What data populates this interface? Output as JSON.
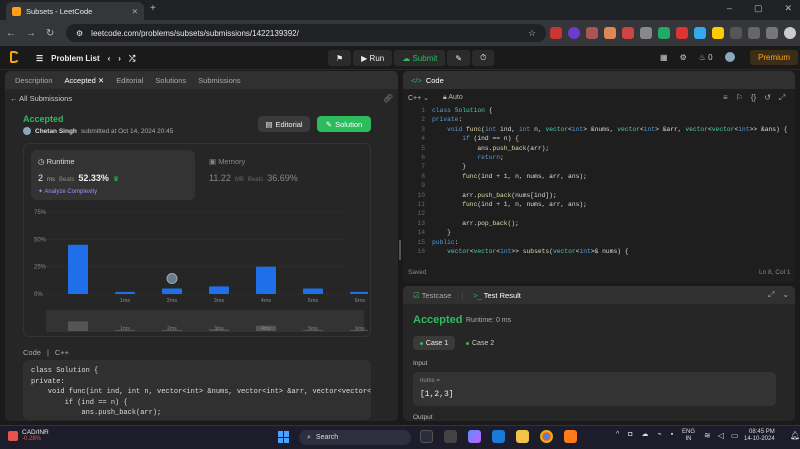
{
  "browser": {
    "tab_title": "Subsets - LeetCode",
    "url": "leetcode.com/problems/subsets/submissions/1422139392/"
  },
  "nav": {
    "problem_list": "Problem List",
    "run": "Run",
    "submit": "Submit",
    "streak": "0",
    "premium": "Premium"
  },
  "left": {
    "tabs": [
      "Description",
      "Accepted",
      "Editorial",
      "Solutions",
      "Submissions"
    ],
    "all_submissions": "All Submissions",
    "status": "Accepted",
    "author": "Chetan Singh",
    "submitted": "submitted at Oct 14, 2024 20:45",
    "editorial_btn": "Editorial",
    "solution_btn": "Solution",
    "runtime_label": "Runtime",
    "runtime_value": "2",
    "runtime_unit": "ms",
    "beats_label": "Beats",
    "runtime_beats": "52.33%",
    "analyze": "Analyze Complexity",
    "memory_label": "Memory",
    "memory_value": "11.22",
    "memory_unit": "MB",
    "memory_beats": "36.69%",
    "code_label": "Code",
    "code_lang": "C++",
    "code_preview": "class Solution {\nprivate:\n    void func(int ind, int n, vector<int> &nums, vector<int> &arr, vector<vector<\n        if (ind == n) {\n            ans.push_back(arr);"
  },
  "chart_data": {
    "type": "bar",
    "categories": [
      "",
      "1ms",
      "2ms",
      "3ms",
      "4ms",
      "5ms",
      "6ms"
    ],
    "values": [
      45,
      2,
      5,
      7,
      25,
      5,
      2
    ],
    "ylim": [
      0,
      75
    ],
    "yticks": [
      "75%",
      "50%",
      "25%",
      "0%"
    ],
    "highlight": "2ms",
    "grid": true,
    "colors": {
      "bar": "#1e6fe8",
      "grid": "#3a3a3a"
    },
    "minimap_labels": [
      "1ms",
      "2ms",
      "3ms",
      "4ms",
      "5ms",
      "6ms"
    ]
  },
  "editor": {
    "panel_title": "Code",
    "lang": "C++",
    "mode": "Auto",
    "lines": [
      "class Solution {",
      "private:",
      "    void func(int ind, int n, vector<int> &nums, vector<int> &arr, vector<vector<int>> &ans) {",
      "        if (ind == n) {",
      "            ans.push_back(arr);",
      "            return;",
      "        }",
      "        func(ind + 1, n, nums, arr, ans);",
      "",
      "        arr.push_back(nums[ind]);",
      "        func(ind + 1, n, nums, arr, ans);",
      "",
      "        arr.pop_back();",
      "    }",
      "public:",
      "    vector<vector<int>> subsets(vector<int>& nums) {"
    ],
    "saved": "Saved",
    "position": "Ln 8, Col 1"
  },
  "result": {
    "tab_testcase": "Testcase",
    "tab_result": "Test Result",
    "status": "Accepted",
    "runtime": "Runtime: 0 ms",
    "case1": "Case 1",
    "case2": "Case 2",
    "input_label": "Input",
    "var_name": "nums =",
    "var_value": "[1,2,3]",
    "output_label": "Output"
  },
  "taskbar": {
    "stock_name": "CAD/INR",
    "stock_change": "-0.28%",
    "search": "Search",
    "lang1": "ENG",
    "lang2": "IN",
    "time": "08:45 PM",
    "date": "14-10-2024"
  }
}
